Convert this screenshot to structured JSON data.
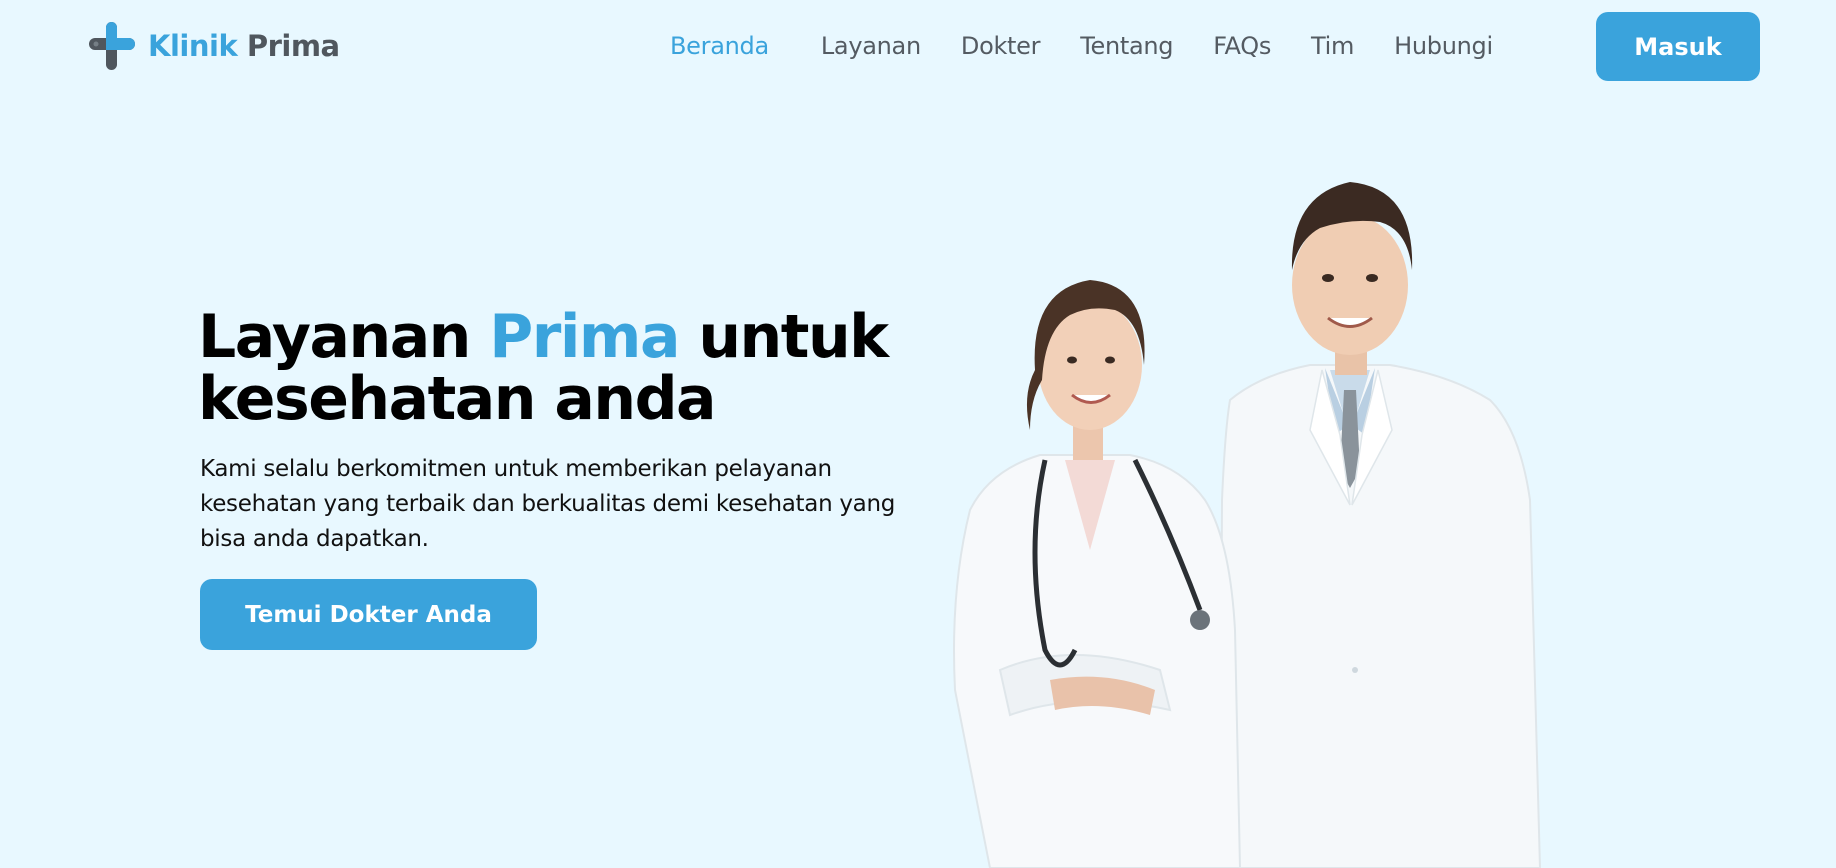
{
  "brand": {
    "name_part1": "Klinik",
    "name_part2": "Prima",
    "logo_icon": "medical-cross-icon"
  },
  "nav": {
    "items": [
      {
        "label": "Beranda",
        "active": true
      },
      {
        "label": "Layanan",
        "active": false
      },
      {
        "label": "Dokter",
        "active": false
      },
      {
        "label": "Tentang",
        "active": false
      },
      {
        "label": "FAQs",
        "active": false
      },
      {
        "label": "Tim",
        "active": false
      },
      {
        "label": "Hubungi",
        "active": false
      }
    ],
    "login_label": "Masuk"
  },
  "hero": {
    "title_part1": "Layanan",
    "title_accent": "Prima",
    "title_part2": "untuk kesehatan anda",
    "description": "Kami selalu berkomitmen untuk memberikan pelayanan kesehatan yang terbaik dan berkualitas demi kesehatan yang bisa anda dapatkan.",
    "cta_label": "Temui Dokter Anda",
    "image": "two-doctors-photo"
  },
  "colors": {
    "accent": "#3aa3dc",
    "background": "#e8f8ff",
    "nav_text": "#545b62",
    "heading": "#000000"
  }
}
